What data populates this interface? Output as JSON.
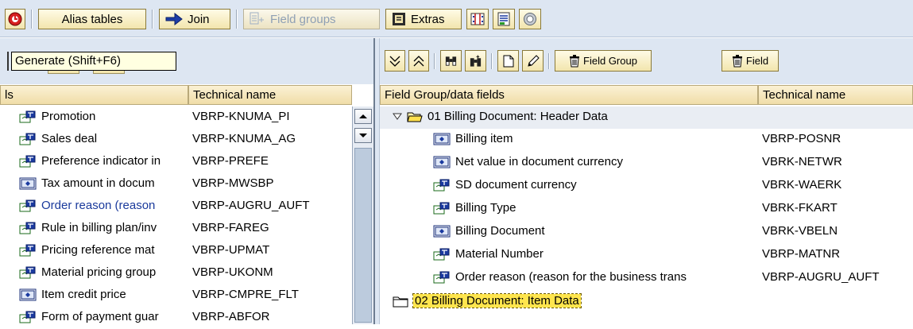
{
  "toolbar": {
    "alias_tables": "Alias tables",
    "join": "Join",
    "field_groups": "Field groups",
    "extras": "Extras"
  },
  "left": {
    "tooltip": "Generate  (Shift+F6)",
    "col1": "ls",
    "col2": "Technical name",
    "rows": [
      {
        "label": "Promotion",
        "tech": "VBRP-KNUMA_PI",
        "icon": "char-field-icon"
      },
      {
        "label": "Sales deal",
        "tech": "VBRP-KNUMA_AG",
        "icon": "char-field-icon"
      },
      {
        "label": "Preference indicator in",
        "tech": "VBRP-PREFE",
        "icon": "char-field-icon"
      },
      {
        "label": "Tax amount in docum",
        "tech": "VBRP-MWSBP",
        "icon": "amount-field-icon"
      },
      {
        "label": "Order reason (reason",
        "tech": "VBRP-AUGRU_AUFT",
        "icon": "char-field-icon",
        "link": true
      },
      {
        "label": "Rule in billing plan/inv",
        "tech": "VBRP-FAREG",
        "icon": "char-field-icon"
      },
      {
        "label": "Pricing reference mat",
        "tech": "VBRP-UPMAT",
        "icon": "char-field-icon"
      },
      {
        "label": "Material pricing group",
        "tech": "VBRP-UKONM",
        "icon": "char-field-icon"
      },
      {
        "label": "Item credit price",
        "tech": "VBRP-CMPRE_FLT",
        "icon": "amount-field-icon"
      },
      {
        "label": "Form of payment guar",
        "tech": "VBRP-ABFOR",
        "icon": "char-field-icon"
      }
    ]
  },
  "right": {
    "btn_field_group": "Field Group",
    "btn_field": "Field",
    "col1": "Field Group/data fields",
    "col2": "Technical name",
    "group1": "01 Billing Document: Header Data",
    "fields": [
      {
        "label": "Billing item",
        "tech": "VBRP-POSNR",
        "icon": "amount-field-icon"
      },
      {
        "label": "Net value in document currency",
        "tech": "VBRK-NETWR",
        "icon": "amount-field-icon"
      },
      {
        "label": "SD document currency",
        "tech": "VBRK-WAERK",
        "icon": "char-field-icon"
      },
      {
        "label": "Billing Type",
        "tech": "VBRK-FKART",
        "icon": "char-field-icon"
      },
      {
        "label": "Billing Document",
        "tech": "VBRK-VBELN",
        "icon": "amount-field-icon"
      },
      {
        "label": "Material Number",
        "tech": "VBRP-MATNR",
        "icon": "char-field-icon"
      },
      {
        "label": "Order reason (reason for the business trans",
        "tech": "VBRP-AUGRU_AUFT",
        "icon": "char-field-icon"
      }
    ],
    "group2": "02 Billing Document: Item Data"
  }
}
